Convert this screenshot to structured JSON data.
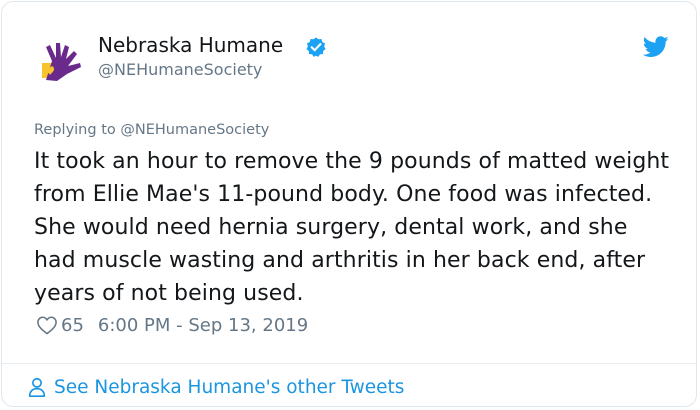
{
  "author": {
    "name": "Nebraska Humane",
    "handle": "@NEHumaneSociety"
  },
  "tweet": {
    "replying_prefix": "Replying to ",
    "replying_handle": "@NEHumaneSociety",
    "text": "It took an hour to remove the 9 pounds of matted weight from Ellie Mae's 11-pound body. One food was infected. She would need hernia surgery, dental work, and she had muscle wasting and arthritis in her back end, after years of not being used.",
    "like_count": "65",
    "timestamp": "6:00 PM - Sep 13, 2019"
  },
  "footer": {
    "link_label": "See Nebraska Humane's other Tweets"
  },
  "icons": {
    "avatar": "hand-heart-logo",
    "verified": "verified-badge-icon",
    "platform": "twitter-bird-icon",
    "like": "heart-outline-icon",
    "profile": "person-outline-icon"
  },
  "colors": {
    "accent": "#1da1f2",
    "link": "#1b95e0",
    "secondary_text": "#657786",
    "logo_purple": "#6a2a8c",
    "logo_yellow": "#f6c42e"
  }
}
